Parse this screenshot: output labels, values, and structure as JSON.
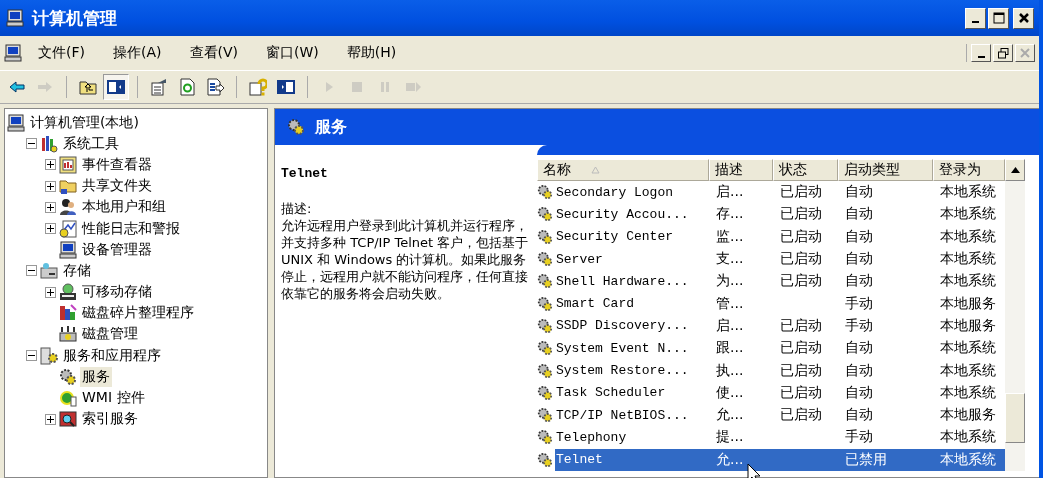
{
  "window": {
    "title": "计算机管理"
  },
  "menu": [
    "文件(F)",
    "操作(A)",
    "查看(V)",
    "窗口(W)",
    "帮助(H)"
  ],
  "toolbar": [
    {
      "kind": "back",
      "disabled": false,
      "pressed": false
    },
    {
      "kind": "forward",
      "disabled": true,
      "pressed": false
    },
    {
      "kind": "sep"
    },
    {
      "kind": "up",
      "disabled": false,
      "pressed": false
    },
    {
      "kind": "tree",
      "disabled": false,
      "pressed": true
    },
    {
      "kind": "sep"
    },
    {
      "kind": "properties",
      "disabled": false,
      "pressed": false
    },
    {
      "kind": "refresh",
      "disabled": false,
      "pressed": false
    },
    {
      "kind": "export",
      "disabled": false,
      "pressed": false
    },
    {
      "kind": "sep"
    },
    {
      "kind": "help",
      "disabled": false,
      "pressed": false
    },
    {
      "kind": "pane",
      "disabled": false,
      "pressed": false
    },
    {
      "kind": "sep"
    },
    {
      "kind": "play",
      "disabled": true,
      "pressed": false
    },
    {
      "kind": "stop",
      "disabled": true,
      "pressed": false
    },
    {
      "kind": "pause",
      "disabled": true,
      "pressed": false
    },
    {
      "kind": "restart",
      "disabled": true,
      "pressed": false
    }
  ],
  "tree": [
    {
      "label": "计算机管理(本地)",
      "kind": "computer",
      "selected": false,
      "children": [
        {
          "label": "系统工具",
          "kind": "tools",
          "selected": false,
          "expanded": true,
          "children": [
            {
              "label": "事件查看器",
              "kind": "event",
              "selected": false,
              "expanded": false
            },
            {
              "label": "共享文件夹",
              "kind": "folder",
              "selected": false,
              "expanded": false
            },
            {
              "label": "本地用户和组",
              "kind": "users",
              "selected": false,
              "expanded": false
            },
            {
              "label": "性能日志和警报",
              "kind": "chart",
              "selected": false,
              "expanded": false
            },
            {
              "label": "设备管理器",
              "kind": "computer",
              "selected": false
            }
          ]
        },
        {
          "label": "存储",
          "kind": "storage",
          "selected": false,
          "expanded": true,
          "children": [
            {
              "label": "可移动存储",
              "kind": "removable",
              "selected": false,
              "expanded": false
            },
            {
              "label": "磁盘碎片整理程序",
              "kind": "defrag",
              "selected": false
            },
            {
              "label": "磁盘管理",
              "kind": "disk",
              "selected": false
            }
          ]
        },
        {
          "label": "服务和应用程序",
          "kind": "server",
          "selected": false,
          "expanded": true,
          "children": [
            {
              "label": "服务",
              "kind": "gears",
              "selected": true
            },
            {
              "label": "WMI 控件",
              "kind": "wmi",
              "selected": false
            },
            {
              "label": "索引服务",
              "kind": "index",
              "selected": false,
              "expanded": false
            }
          ]
        }
      ]
    }
  ],
  "panel": {
    "title": "服务"
  },
  "detail": {
    "name": "Telnet",
    "label": "描述:",
    "text": "允许远程用户登录到此计算机并运行程序，并支持多种 TCP/IP Telnet 客户，包括基于 UNIX 和 Windows 的计算机。如果此服务停止，远程用户就不能访问程序，任何直接依靠它的服务将会启动失败。"
  },
  "table": {
    "columns": [
      "名称",
      "描述",
      "状态",
      "启动类型",
      "登录为"
    ],
    "rows": [
      {
        "name": "Secondary Logon",
        "desc": "启...",
        "status": "已启动",
        "startup": "自动",
        "logon": "本地系统",
        "selected": false
      },
      {
        "name": "Security Accou...",
        "desc": "存...",
        "status": "已启动",
        "startup": "自动",
        "logon": "本地系统",
        "selected": false
      },
      {
        "name": "Security Center",
        "desc": "监...",
        "status": "已启动",
        "startup": "自动",
        "logon": "本地系统",
        "selected": false
      },
      {
        "name": "Server",
        "desc": "支...",
        "status": "已启动",
        "startup": "自动",
        "logon": "本地系统",
        "selected": false
      },
      {
        "name": "Shell Hardware...",
        "desc": "为...",
        "status": "已启动",
        "startup": "自动",
        "logon": "本地系统",
        "selected": false
      },
      {
        "name": "Smart Card",
        "desc": "管...",
        "startup": "手动",
        "logon": "本地服务",
        "selected": false
      },
      {
        "name": "SSDP Discovery...",
        "desc": "启...",
        "status": "已启动",
        "startup": "手动",
        "logon": "本地服务",
        "selected": false
      },
      {
        "name": "System Event N...",
        "desc": "跟...",
        "status": "已启动",
        "startup": "自动",
        "logon": "本地系统",
        "selected": false
      },
      {
        "name": "System Restore...",
        "desc": "执...",
        "status": "已启动",
        "startup": "自动",
        "logon": "本地系统",
        "selected": false
      },
      {
        "name": "Task Scheduler",
        "desc": "使...",
        "status": "已启动",
        "startup": "自动",
        "logon": "本地系统",
        "selected": false
      },
      {
        "name": "TCP/IP NetBIOS...",
        "desc": "允...",
        "status": "已启动",
        "startup": "自动",
        "logon": "本地服务",
        "selected": false
      },
      {
        "name": "Telephony",
        "desc": "提...",
        "startup": "手动",
        "logon": "本地系统",
        "selected": false
      },
      {
        "name": "Telnet",
        "desc": "允...",
        "startup": "已禁用",
        "logon": "本地系统",
        "selected": true
      }
    ]
  }
}
